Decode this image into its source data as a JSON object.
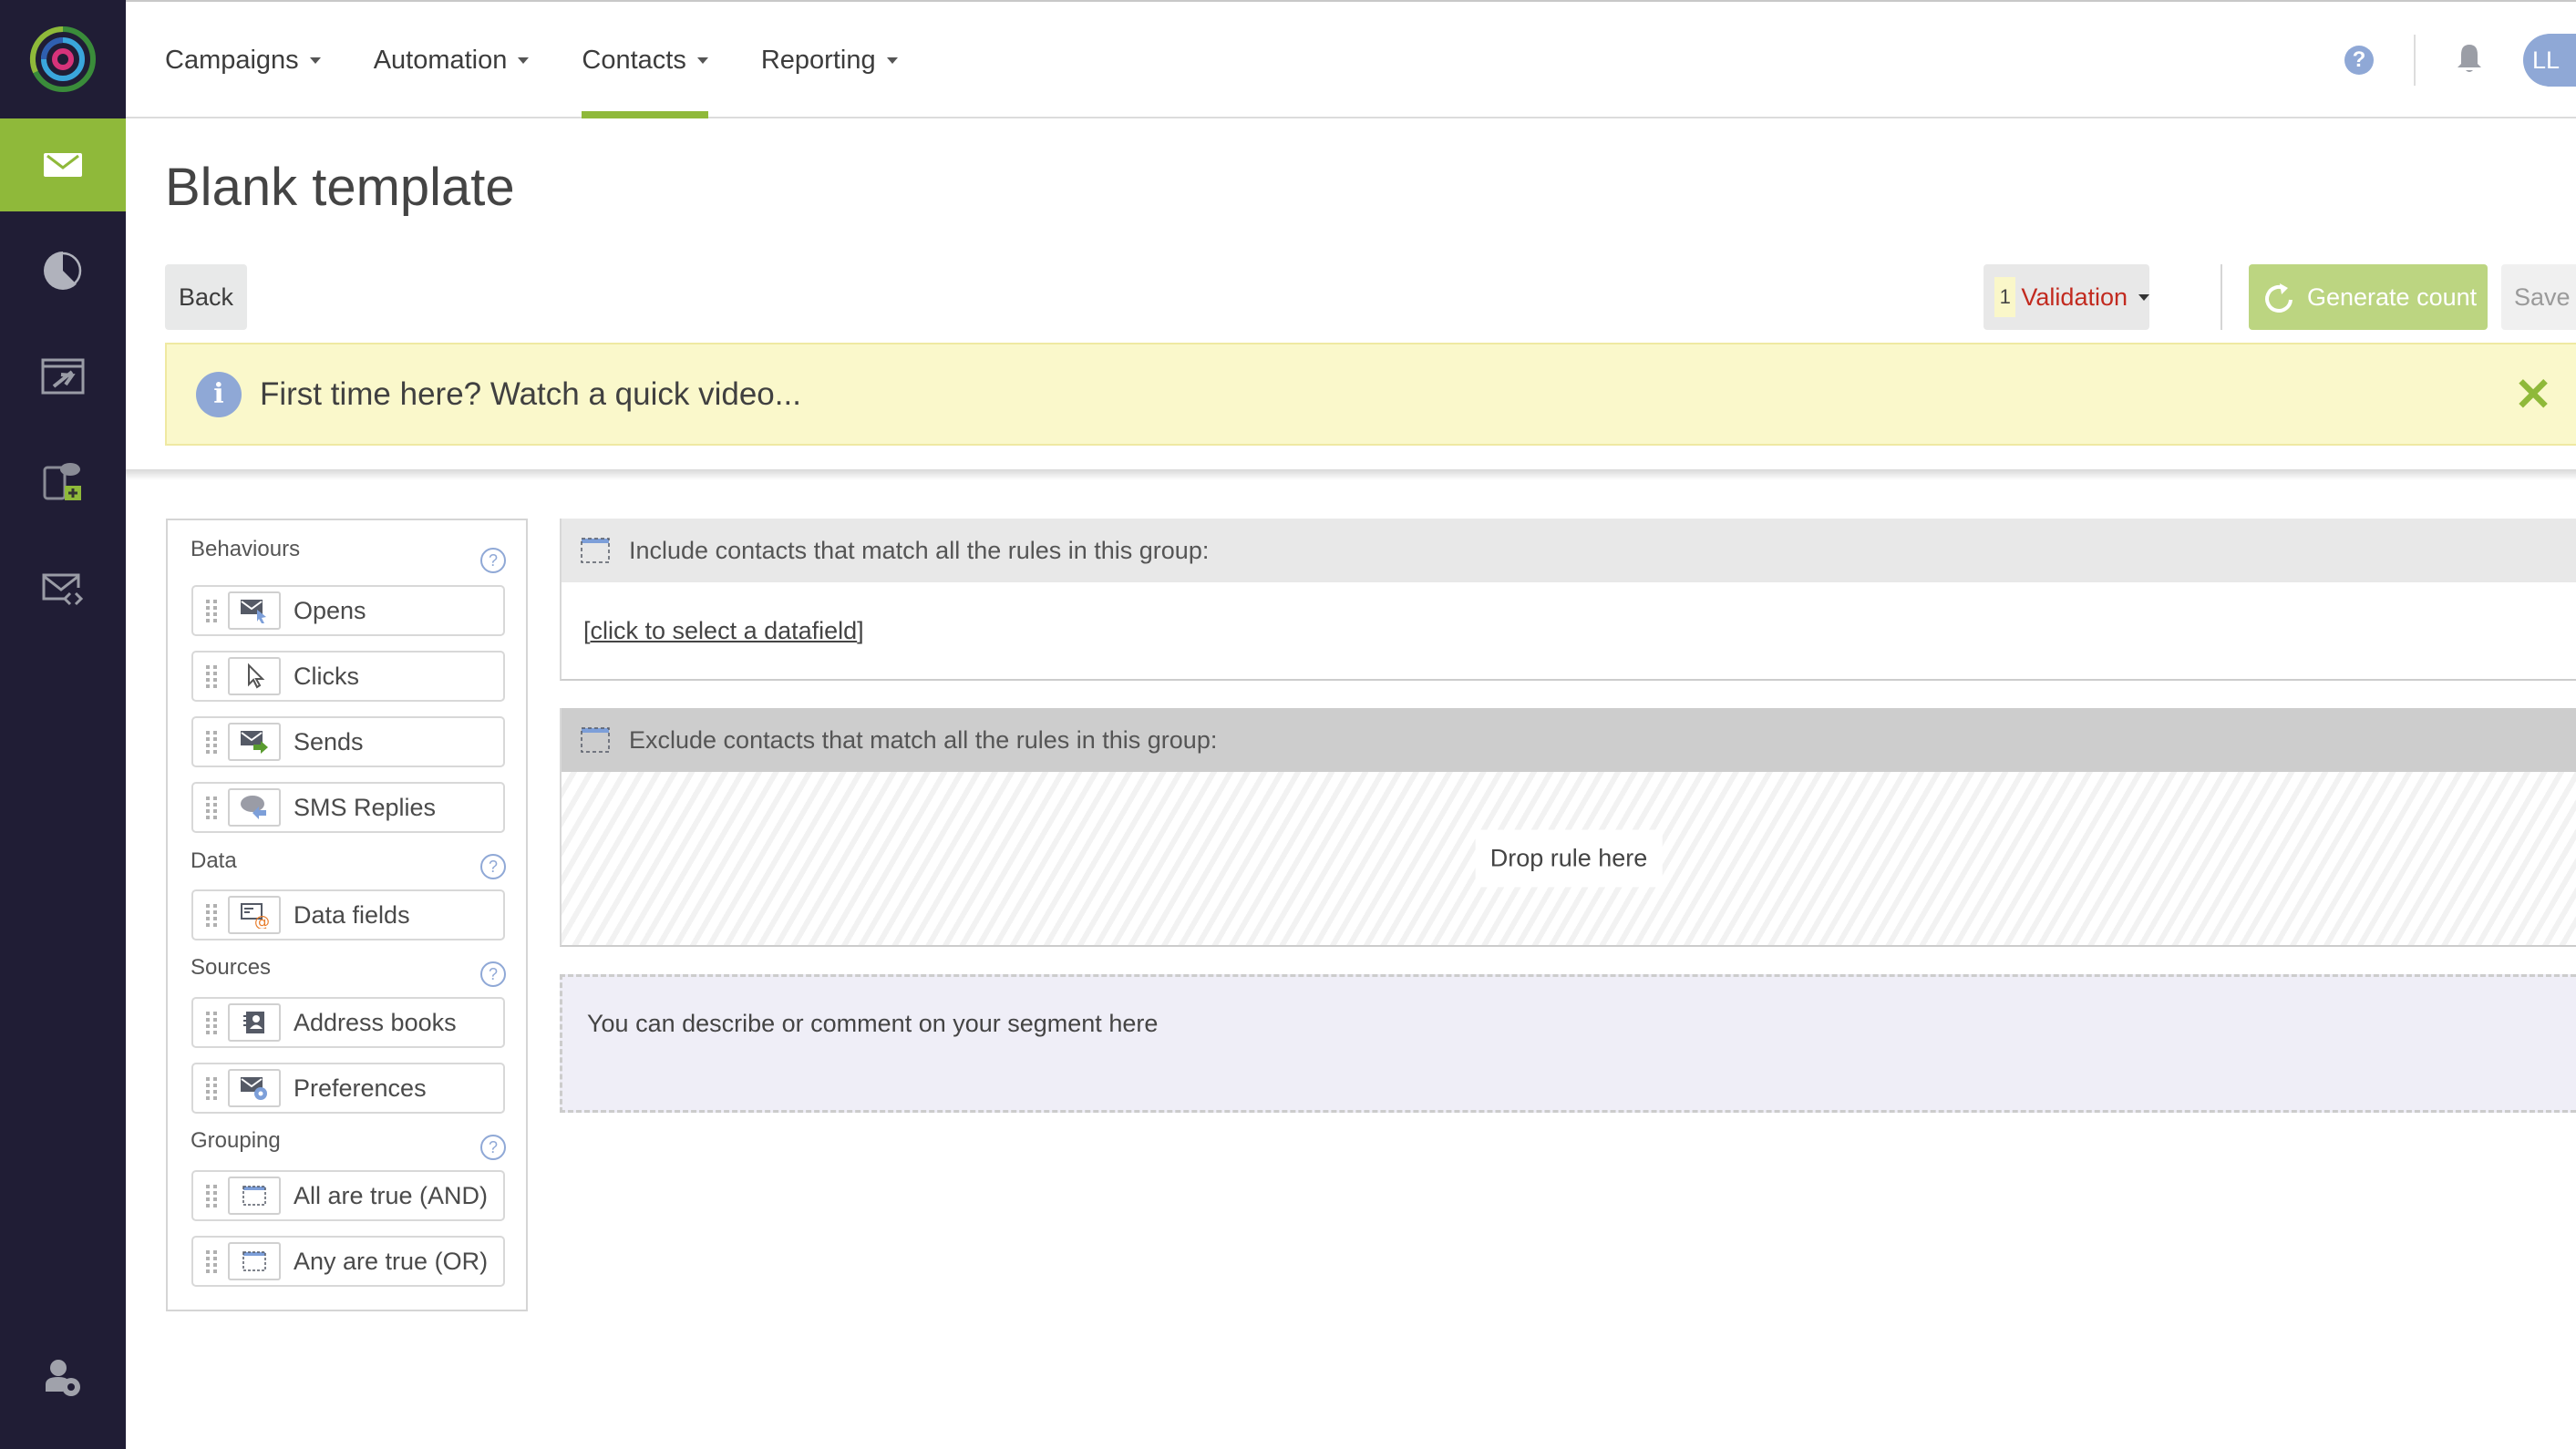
{
  "sidebar": {
    "logo": "brand-logo",
    "items": [
      {
        "name": "email-campaigns",
        "icon": "envelope-icon",
        "active": true
      },
      {
        "name": "reports",
        "icon": "pie-chart-icon",
        "active": false
      },
      {
        "name": "landing-pages",
        "icon": "browser-plane-icon",
        "active": false
      },
      {
        "name": "sms",
        "icon": "phone-sms-add-icon",
        "active": false
      },
      {
        "name": "email-code",
        "icon": "envelope-code-icon",
        "active": false
      }
    ],
    "bottom_item": {
      "name": "account-settings",
      "icon": "user-gear-icon"
    }
  },
  "topnav": {
    "items": [
      {
        "label": "Campaigns",
        "active": false
      },
      {
        "label": "Automation",
        "active": false
      },
      {
        "label": "Contacts",
        "active": true
      },
      {
        "label": "Reporting",
        "active": false
      }
    ],
    "help_label": "?",
    "avatar_initials": "LL"
  },
  "page": {
    "title": "Blank template"
  },
  "toolbar": {
    "back_label": "Back",
    "validation_count": "1",
    "validation_label": "Validation",
    "generate_label": "Generate count",
    "save_label": "Save"
  },
  "banner": {
    "message": "First time here? Watch a quick video...",
    "info_glyph": "i",
    "close_glyph": "✕"
  },
  "palette": {
    "sections": [
      {
        "title": "Behaviours",
        "items": [
          {
            "label": "Opens",
            "icon": "envelope-open-icon"
          },
          {
            "label": "Clicks",
            "icon": "cursor-icon"
          },
          {
            "label": "Sends",
            "icon": "envelope-send-icon"
          },
          {
            "label": "SMS Replies",
            "icon": "sms-reply-icon"
          }
        ]
      },
      {
        "title": "Data",
        "items": [
          {
            "label": "Data fields",
            "icon": "data-field-icon"
          }
        ]
      },
      {
        "title": "Sources",
        "items": [
          {
            "label": "Address books",
            "icon": "address-book-icon"
          },
          {
            "label": "Preferences",
            "icon": "preferences-icon"
          }
        ]
      },
      {
        "title": "Grouping",
        "items": [
          {
            "label": "All are true (AND)",
            "icon": "group-and-icon"
          },
          {
            "label": "Any are true (OR)",
            "icon": "group-or-icon"
          }
        ]
      }
    ],
    "help_glyph": "?"
  },
  "segment": {
    "include_title": "Include contacts that match all the rules in this group:",
    "include_link": "click to select a datafield",
    "exclude_title": "Exclude contacts that match all the rules in this group:",
    "drop_text": "Drop rule here",
    "comment_placeholder": "You can describe or comment on your segment here"
  },
  "colors": {
    "sidebar_bg": "#201d35",
    "accent_green": "#8fb93a",
    "generate_green": "#bcd581",
    "validation_red": "#c22a1f",
    "banner_yellow": "#faf8cb",
    "help_blue": "#8fa8d6"
  }
}
